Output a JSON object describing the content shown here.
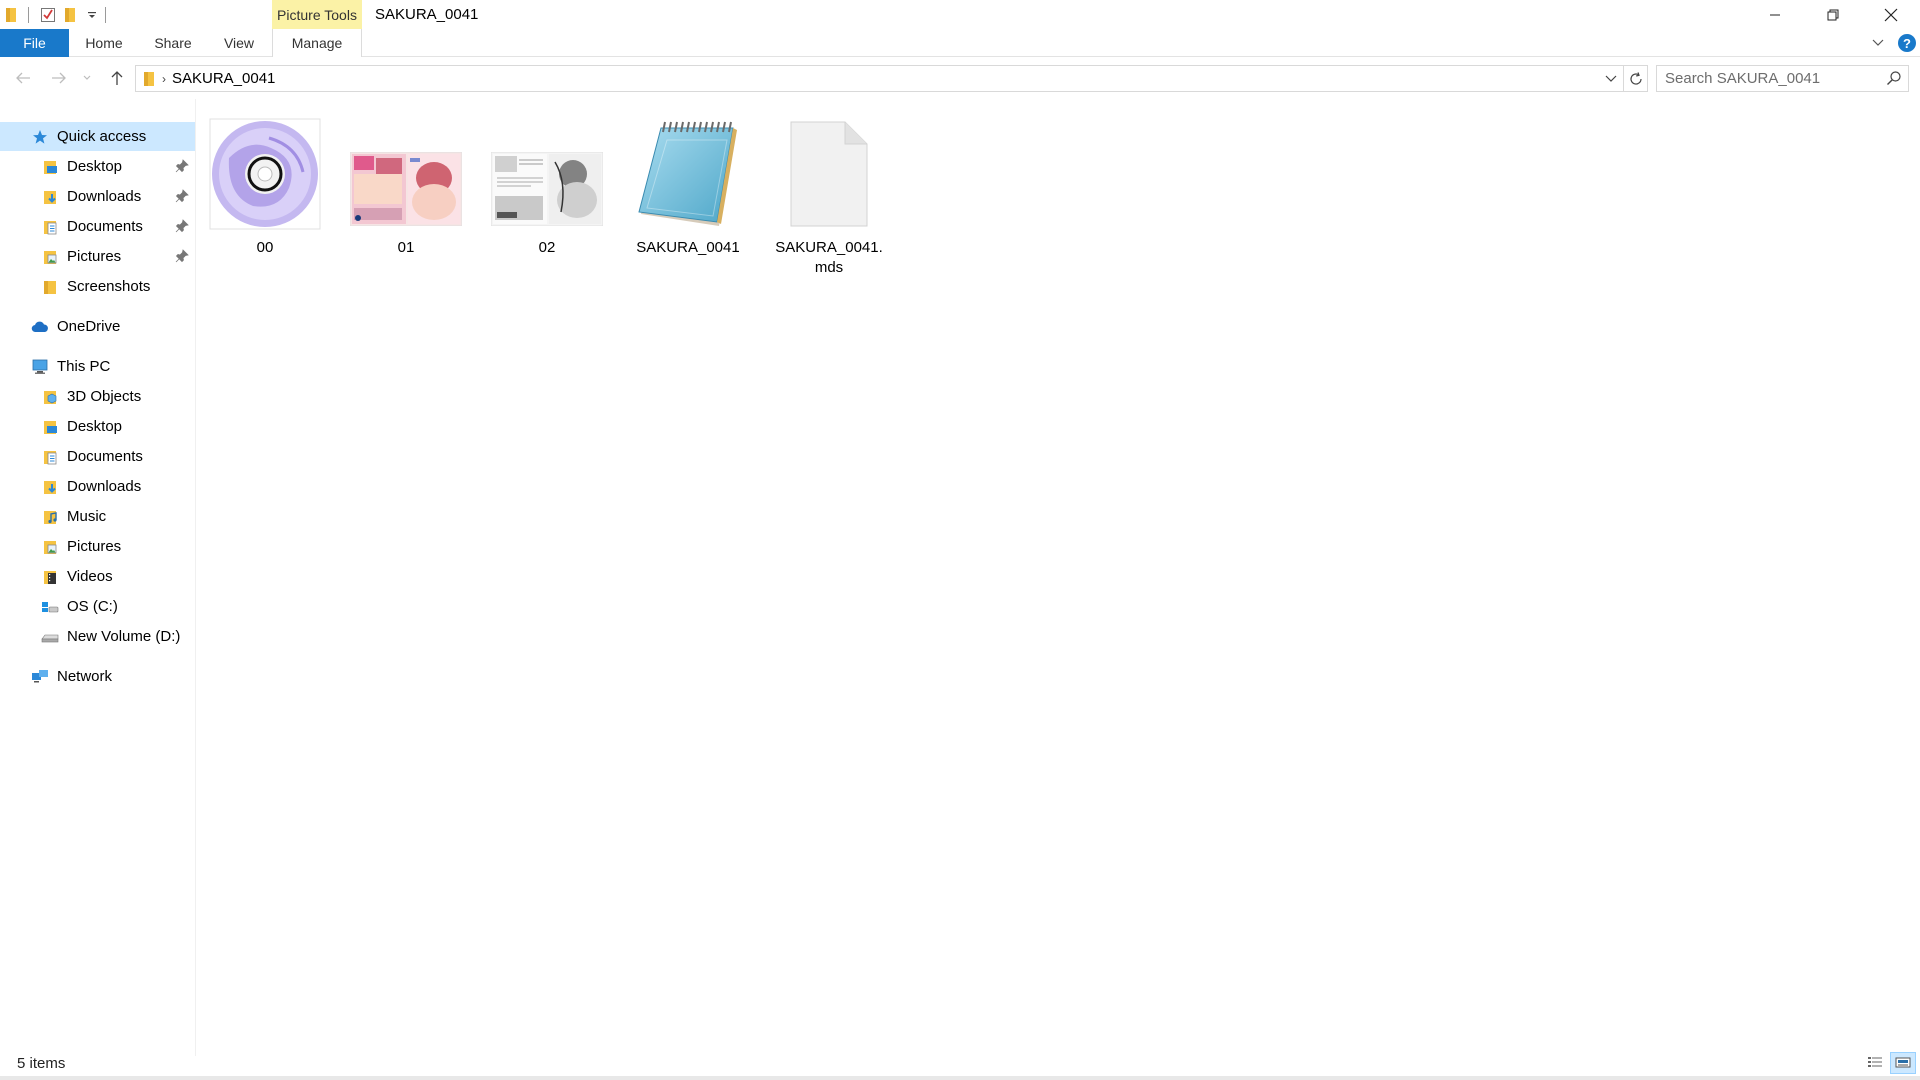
{
  "window": {
    "title": "SAKURA_0041",
    "context_tab_group": "Picture Tools"
  },
  "ribbon": {
    "tabs": [
      {
        "label": "File"
      },
      {
        "label": "Home"
      },
      {
        "label": "Share"
      },
      {
        "label": "View"
      },
      {
        "label": "Manage"
      }
    ]
  },
  "address_bar": {
    "crumbs": [
      "SAKURA_0041"
    ]
  },
  "search": {
    "placeholder": "Search SAKURA_0041"
  },
  "nav_pane": {
    "quick_access": {
      "label": "Quick access"
    },
    "quick_items": [
      {
        "label": "Desktop",
        "pinned": true,
        "icon": "desktop-folder-icon"
      },
      {
        "label": "Downloads",
        "pinned": true,
        "icon": "downloads-folder-icon"
      },
      {
        "label": "Documents",
        "pinned": true,
        "icon": "documents-folder-icon"
      },
      {
        "label": "Pictures",
        "pinned": true,
        "icon": "pictures-folder-icon"
      },
      {
        "label": "Screenshots",
        "pinned": false,
        "icon": "folder-icon"
      }
    ],
    "onedrive": {
      "label": "OneDrive"
    },
    "this_pc": {
      "label": "This PC"
    },
    "pc_items": [
      {
        "label": "3D Objects",
        "icon": "3d-objects-folder-icon"
      },
      {
        "label": "Desktop",
        "icon": "desktop-folder-icon"
      },
      {
        "label": "Documents",
        "icon": "documents-folder-icon"
      },
      {
        "label": "Downloads",
        "icon": "downloads-folder-icon"
      },
      {
        "label": "Music",
        "icon": "music-folder-icon"
      },
      {
        "label": "Pictures",
        "icon": "pictures-folder-icon"
      },
      {
        "label": "Videos",
        "icon": "videos-folder-icon"
      },
      {
        "label": "OS (C:)",
        "icon": "os-drive-icon"
      },
      {
        "label": "New Volume (D:)",
        "icon": "drive-icon"
      }
    ],
    "network": {
      "label": "Network"
    }
  },
  "files": [
    {
      "name": "00",
      "kind": "disc-image-thumbnail"
    },
    {
      "name": "01",
      "kind": "cover-image-thumbnail"
    },
    {
      "name": "02",
      "kind": "manga-page-thumbnail"
    },
    {
      "name": "SAKURA_0041",
      "kind": "notepad-text-icon"
    },
    {
      "name": "SAKURA_0041.mds",
      "kind": "blank-file-icon"
    }
  ],
  "status": {
    "item_count": "5 items"
  },
  "colors": {
    "accent": "#1979ca",
    "selection": "#cce8ff",
    "context_tab": "#fbf2a6"
  }
}
